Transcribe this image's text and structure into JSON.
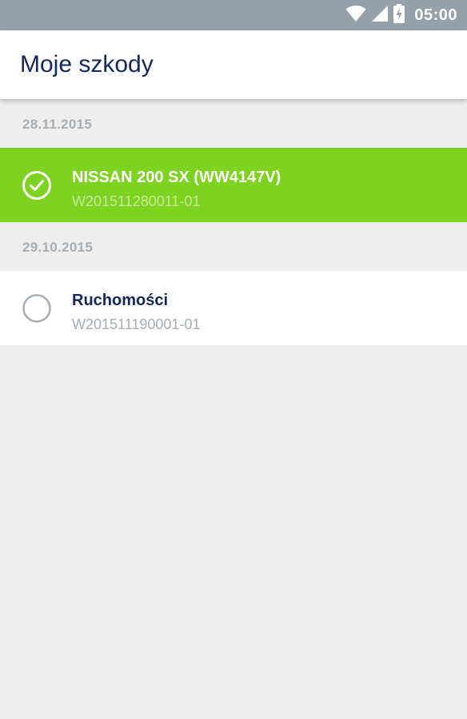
{
  "status_bar": {
    "time": "05:00",
    "icons": [
      "wifi-icon",
      "signal-icon",
      "battery-charging-icon"
    ]
  },
  "app_bar": {
    "title": "Moje szkody"
  },
  "claims": [
    {
      "date": "28.11.2015",
      "items": [
        {
          "name": "NISSAN 200 SX (WW4147V)",
          "number": "W201511280011-01",
          "selected": true
        }
      ]
    },
    {
      "date": "29.10.2015",
      "items": [
        {
          "name": "Ruchomości",
          "number": "W201511190001-01",
          "selected": false
        }
      ]
    }
  ],
  "colors": {
    "status_bar": "#95a1aa",
    "accent_green": "#7ed321",
    "title_navy": "#14275c",
    "muted_gray": "#a7adb1",
    "background": "#eeeeee"
  }
}
